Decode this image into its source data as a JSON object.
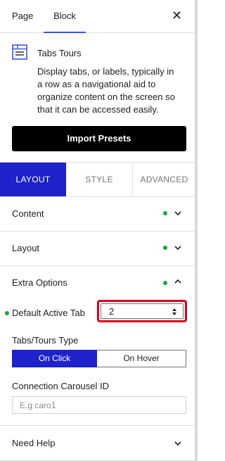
{
  "header": {
    "tabs": [
      "Page",
      "Block"
    ],
    "active_tab": "Block",
    "close_icon": "close-icon"
  },
  "block": {
    "icon": "tabs-block-icon",
    "title": "Tabs Tours",
    "description": "Display tabs, or labels, typically in a row as a navigational aid to organize content on the screen so that it can be accessed easily."
  },
  "import_button": "Import Presets",
  "panel_tabs": [
    "LAYOUT",
    "STYLE",
    "ADVANCED"
  ],
  "active_panel_tab": "LAYOUT",
  "sections": {
    "content": "Content",
    "layout": "Layout",
    "extra_options": "Extra Options",
    "need_help": "Need Help"
  },
  "extra_options": {
    "default_active_tab_label": "Default Active Tab",
    "default_active_tab_value": "2",
    "type_label": "Tabs/Tours Type",
    "type_options": [
      "On Click",
      "On Hover"
    ],
    "type_selected": "On Click",
    "connection_label": "Connection Carousel ID",
    "connection_placeholder": "E.g caro1",
    "connection_value": ""
  },
  "colors": {
    "accent": "#1e22c8",
    "status_dot": "#1ca33b",
    "highlight_border": "#d8001a"
  }
}
